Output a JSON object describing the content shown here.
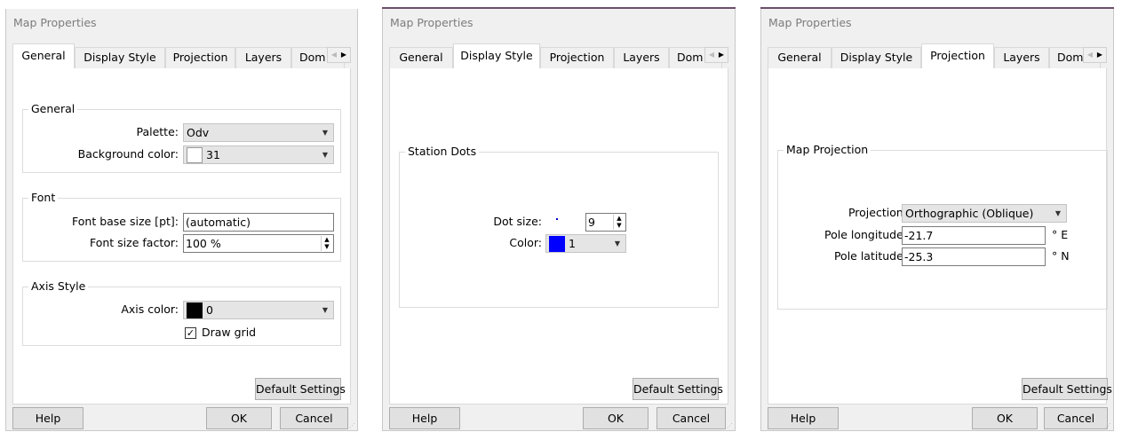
{
  "dialogs": [
    {
      "title": "Map Properties",
      "tabs": [
        "General",
        "Display Style",
        "Projection",
        "Layers",
        "Dom"
      ],
      "active_tab": "General",
      "groups": {
        "general": {
          "title": "General",
          "palette_label": "Palette:",
          "palette_value": "Odv",
          "bg_color_label": "Background color:",
          "bg_color_value": "31"
        },
        "font": {
          "title": "Font",
          "base_size_label": "Font base size [pt]:",
          "base_size_value": "(automatic)",
          "size_factor_label": "Font size factor:",
          "size_factor_value": "100 %"
        },
        "axis": {
          "title": "Axis Style",
          "axis_color_label": "Axis color:",
          "axis_color_value": "0",
          "draw_grid_label": "Draw grid",
          "draw_grid_checked": true
        }
      },
      "default_settings": "Default Settings",
      "help": "Help",
      "ok": "OK",
      "cancel": "Cancel"
    },
    {
      "title": "Map Properties",
      "tabs": [
        "General",
        "Display Style",
        "Projection",
        "Layers",
        "Dom"
      ],
      "active_tab": "Display Style",
      "groups": {
        "station_dots": {
          "title": "Station Dots",
          "dot_size_label": "Dot size:",
          "dot_size_value": "9",
          "color_label": "Color:",
          "color_value": "1"
        }
      },
      "default_settings": "Default Settings",
      "help": "Help",
      "ok": "OK",
      "cancel": "Cancel"
    },
    {
      "title": "Map Properties",
      "tabs": [
        "General",
        "Display Style",
        "Projection",
        "Layers",
        "Dom"
      ],
      "active_tab": "Projection",
      "groups": {
        "map_projection": {
          "title": "Map Projection",
          "projection_label": "Projection:",
          "projection_value": "Orthographic (Oblique)",
          "pole_lon_label": "Pole longitude:",
          "pole_lon_value": "-21.7",
          "pole_lon_unit": "° E",
          "pole_lat_label": "Pole latitude:",
          "pole_lat_value": "-25.3",
          "pole_lat_unit": "° N"
        }
      },
      "default_settings": "Default Settings",
      "help": "Help",
      "ok": "OK",
      "cancel": "Cancel"
    }
  ],
  "colors": {
    "bg_swatch": "#ffffff",
    "axis_swatch": "#000000",
    "dot_swatch": "#0000ff",
    "dot": "#0000d0"
  },
  "icons": {
    "dropdown": "chevron-down-icon",
    "spin": "spin-arrows-icon",
    "tab_scroll": "tab-scroll-arrows-icon"
  }
}
